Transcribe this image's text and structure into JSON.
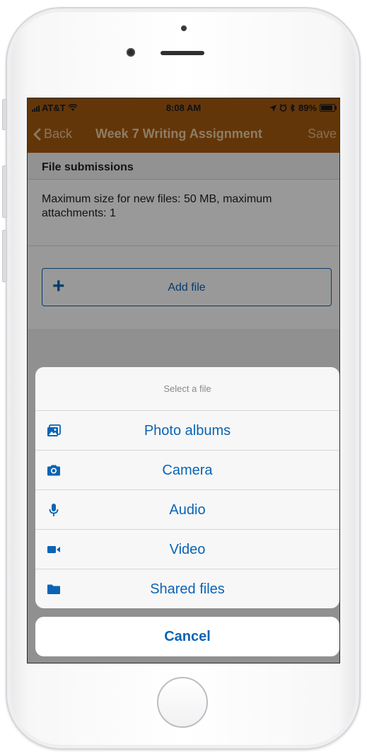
{
  "status_bar": {
    "carrier": "AT&T",
    "time": "8:08 AM",
    "battery": "89%",
    "battery_level": 0.89
  },
  "nav_bar": {
    "back_label": "Back",
    "title": "Week 7 Writing Assignment",
    "save_label": "Save"
  },
  "file_submissions": {
    "header": "File submissions",
    "info": "Maximum size for new files: 50 MB, maximum attachments: 1",
    "add_file_label": "Add file"
  },
  "action_sheet": {
    "title": "Select a file",
    "items": [
      {
        "label": "Photo albums",
        "icon": "photo-album-icon"
      },
      {
        "label": "Camera",
        "icon": "camera-icon"
      },
      {
        "label": "Audio",
        "icon": "microphone-icon"
      },
      {
        "label": "Video",
        "icon": "video-camera-icon"
      },
      {
        "label": "Shared files",
        "icon": "folder-icon"
      }
    ],
    "cancel_label": "Cancel"
  },
  "colors": {
    "nav_background": "#a55b12",
    "accent": "#0a64b4"
  }
}
